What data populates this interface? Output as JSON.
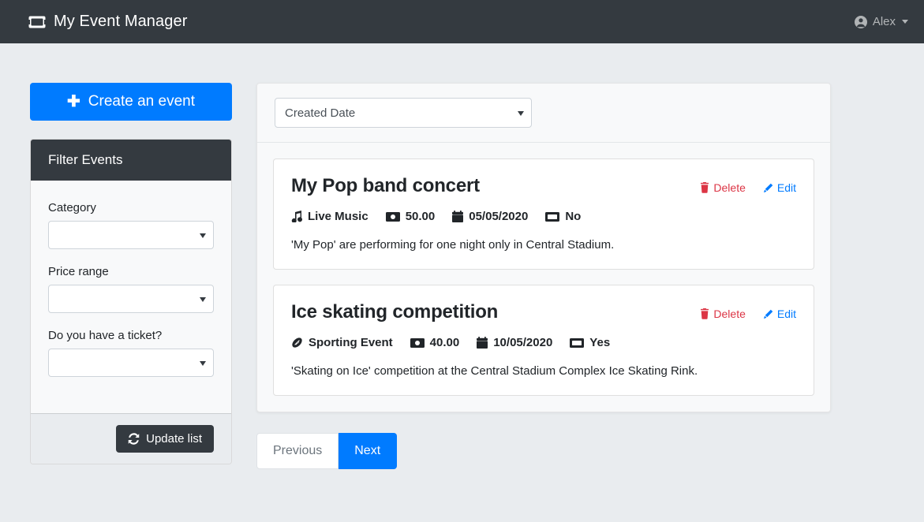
{
  "navbar": {
    "brand_label": "My Event Manager",
    "brand_icon": "ticket-icon",
    "user_label": "Alex",
    "user_icon": "user-circle-icon",
    "caret_icon": "caret-down-icon"
  },
  "sidebar": {
    "create_button": {
      "label": "Create an event",
      "icon": "plus-icon"
    },
    "filter_card": {
      "title": "Filter Events",
      "fields": [
        {
          "label": "Category",
          "value": "",
          "icon": "chevron-down-icon"
        },
        {
          "label": "Price range",
          "value": "",
          "icon": "chevron-down-icon"
        },
        {
          "label": "Do you have a ticket?",
          "value": "",
          "icon": "chevron-down-icon"
        }
      ],
      "update_button": {
        "label": "Update list",
        "icon": "sync-icon"
      }
    }
  },
  "main": {
    "sort": {
      "value": "Created Date",
      "icon": "chevron-down-icon"
    },
    "events": [
      {
        "title": "My Pop band concert",
        "category": "Live Music",
        "category_icon": "music-icon",
        "price": "50.00",
        "price_icon": "money-bill-icon",
        "date": "05/05/2020",
        "date_icon": "calendar-icon",
        "ticket": "No",
        "ticket_icon": "ticket-icon",
        "description": "'My Pop' are performing for one night only in Central Stadium.",
        "delete_label": "Delete",
        "edit_label": "Edit"
      },
      {
        "title": "Ice skating competition",
        "category": "Sporting Event",
        "category_icon": "football-icon",
        "price": "40.00",
        "price_icon": "money-bill-icon",
        "date": "10/05/2020",
        "date_icon": "calendar-icon",
        "ticket": "Yes",
        "ticket_icon": "ticket-icon",
        "description": "'Skating on Ice' competition at the Central Stadium Complex Ice Skating Rink.",
        "delete_label": "Delete",
        "edit_label": "Edit"
      }
    ],
    "pagination": {
      "previous_label": "Previous",
      "next_label": "Next",
      "active": "Next"
    }
  },
  "colors": {
    "primary": "#007bff",
    "dark": "#343a40",
    "danger": "#dc3545",
    "page_bg": "#e9ecef",
    "panel_bg": "#f8f9fa"
  }
}
